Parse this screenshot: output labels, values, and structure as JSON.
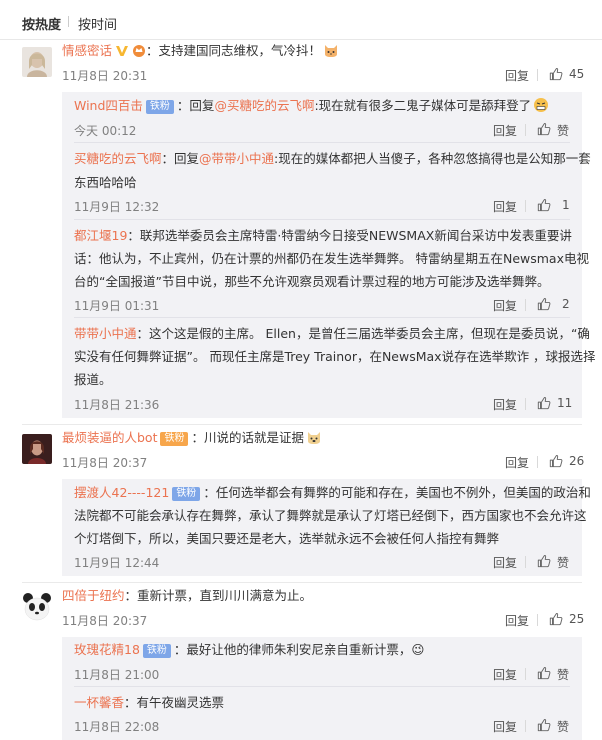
{
  "sort": {
    "hot": "按热度",
    "time": "按时间"
  },
  "actions": {
    "reply": "回复",
    "like": "赞"
  },
  "comments": [
    {
      "name": "情感密话",
      "text": "：支持建国同志维权，气冷抖！",
      "time": "11月8日 20:31",
      "likes": "45",
      "replies": [
        {
          "name": "Wind四百击",
          "badge": "铁粉",
          "prefix": "：回复",
          "at": "@买糖吃的云飞啊",
          "text": ":现在就有很多二鬼子媒体可是舔拜登了",
          "time": "今天 00:12",
          "likes": "赞"
        },
        {
          "name": "买糖吃的云飞啊",
          "prefix": "：回复",
          "at": "@带带小中通",
          "text1": ":现在的媒体都把人当傻子，各种忽悠搞得也是公知那一套",
          "text2": "东西哈哈哈",
          "time": "11月9日 12:32",
          "likes": "1"
        },
        {
          "name": "都江堰19",
          "text1": "：联邦选举委员会主席特雷·特雷纳今日接受NEWSMAX新闻台采访中发表重要讲",
          "text2": "话：他认为，不止宾州，仍在计票的州都仍在发生选举舞弊。 特雷纳星期五在Newsmax电视",
          "text3": "台的“全国报道”节目中说，那些不允许观察员观看计票过程的地方可能涉及选举舞弊。",
          "time": "11月9日 01:31",
          "likes": "2"
        },
        {
          "name": "带带小中通",
          "text1": "：这个这是假的主席。 Ellen，是曾任三届选举委员会主席，但现在是委员说，“确",
          "text2": "实没有任何舞弊证据”。 而现任主席是Trey Trainor，在NewsMax说存在选举欺诈 ，球报选择",
          "text3": "报道。",
          "time": "11月8日 21:36",
          "likes": "11"
        }
      ]
    },
    {
      "name": "最烦装逼的人bot",
      "badge": "铁粉",
      "text": "：川说的话就是证据",
      "time": "11月8日 20:37",
      "likes": "26",
      "replies": [
        {
          "name": "摆渡人42----121",
          "badge": "铁粉",
          "text1": "：任何选举都会有舞弊的可能和存在，美国也不例外，但美国的政治和",
          "text2": "法院都不可能会承认存在舞弊，承认了舞弊就是承认了灯塔已经倒下，西方国家也不会允许这",
          "text3": "个灯塔倒下，所以，美国只要还是老大，选举就永远不会被任何人指控有舞弊",
          "time": "11月9日 12:44",
          "likes": "赞"
        }
      ]
    },
    {
      "name": "四倍于纽约",
      "text": "：重新计票，直到川川满意为止。",
      "time": "11月8日 20:37",
      "likes": "25",
      "replies": [
        {
          "name": "玫瑰花精18",
          "badge": "铁粉",
          "text": "：最好让他的律师朱利安尼亲自重新计票，😉",
          "time": "11月8日 21:00",
          "likes": "赞"
        },
        {
          "name": "一杯馨香",
          "text": "：有午夜幽灵选票",
          "time": "11月8日 22:08",
          "likes": "赞"
        }
      ]
    }
  ],
  "colors": {
    "name": "#eb7350",
    "meta": "#808080",
    "reply_bg": "#f2f2f5",
    "badge": "#7ea6e8"
  }
}
